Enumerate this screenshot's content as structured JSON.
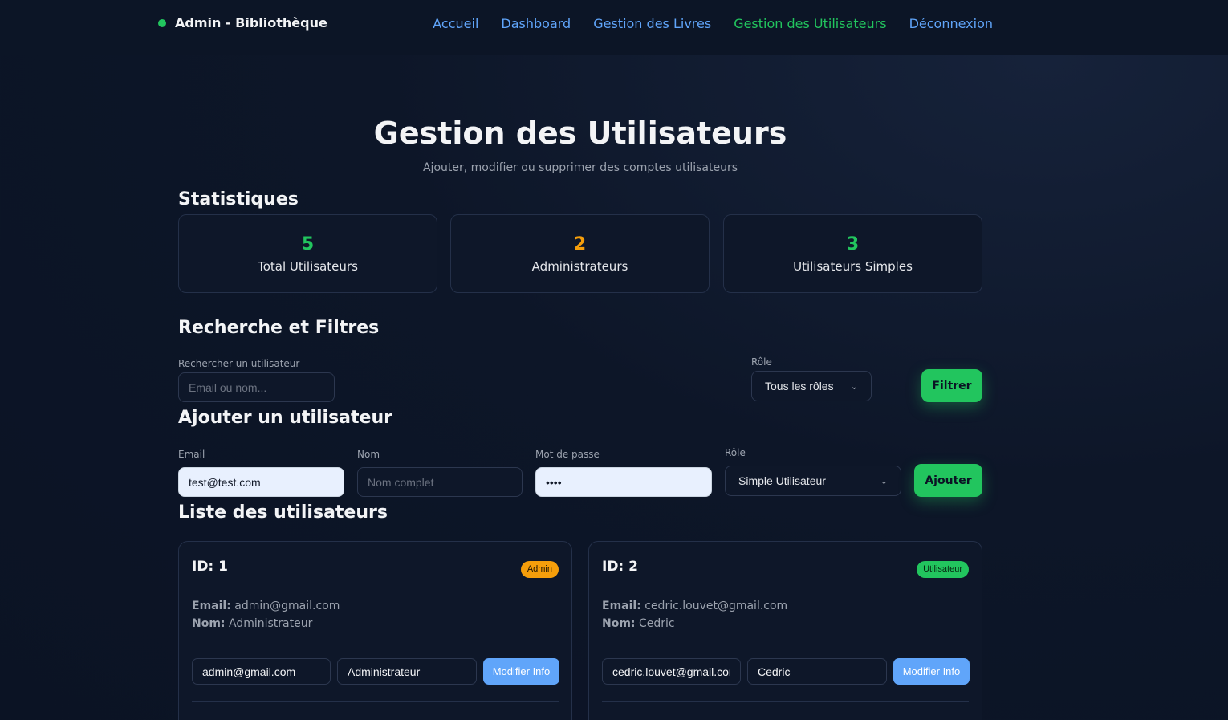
{
  "navbar": {
    "brand": "Admin - Bibliothèque",
    "links": [
      {
        "label": "Accueil",
        "active": false
      },
      {
        "label": "Dashboard",
        "active": false
      },
      {
        "label": "Gestion des Livres",
        "active": false
      },
      {
        "label": "Gestion des Utilisateurs",
        "active": true
      },
      {
        "label": "Déconnexion",
        "active": false
      }
    ]
  },
  "header": {
    "title": "Gestion des Utilisateurs",
    "subtitle": "Ajouter, modifier ou supprimer des comptes utilisateurs"
  },
  "stats": {
    "title": "Statistiques",
    "cards": [
      {
        "value": "5",
        "label": "Total Utilisateurs",
        "color": "#22c55e"
      },
      {
        "value": "2",
        "label": "Administrateurs",
        "color": "#f59e0b"
      },
      {
        "value": "3",
        "label": "Utilisateurs Simples",
        "color": "#22c55e"
      }
    ]
  },
  "search": {
    "title": "Recherche et Filtres",
    "search_label": "Rechercher un utilisateur",
    "search_placeholder": "Email ou nom...",
    "role_label": "Rôle",
    "role_selected": "Tous les rôles",
    "filter_button": "Filtrer"
  },
  "add_user": {
    "title": "Ajouter un utilisateur",
    "email_label": "Email",
    "email_value": "test@test.com",
    "name_label": "Nom",
    "name_placeholder": "Nom complet",
    "password_label": "Mot de passe",
    "password_value": "test",
    "role_label": "Rôle",
    "role_selected": "Simple Utilisateur",
    "add_button": "Ajouter"
  },
  "user_list": {
    "title": "Liste des utilisateurs",
    "email_prefix": "Email:",
    "name_prefix": "Nom:",
    "modify_button": "Modifier Info",
    "users": [
      {
        "id": "ID: 1",
        "badge": "Admin",
        "email": "admin@gmail.com",
        "name": "Administrateur"
      },
      {
        "id": "ID: 2",
        "badge": "Utilisateur",
        "email": "cedric.louvet@gmail.com",
        "name": "Cedric"
      }
    ]
  },
  "colors": {
    "accent_green": "#22c55e",
    "accent_blue": "#60a5fa",
    "accent_orange": "#f59e0b",
    "background": "#0b1324"
  }
}
